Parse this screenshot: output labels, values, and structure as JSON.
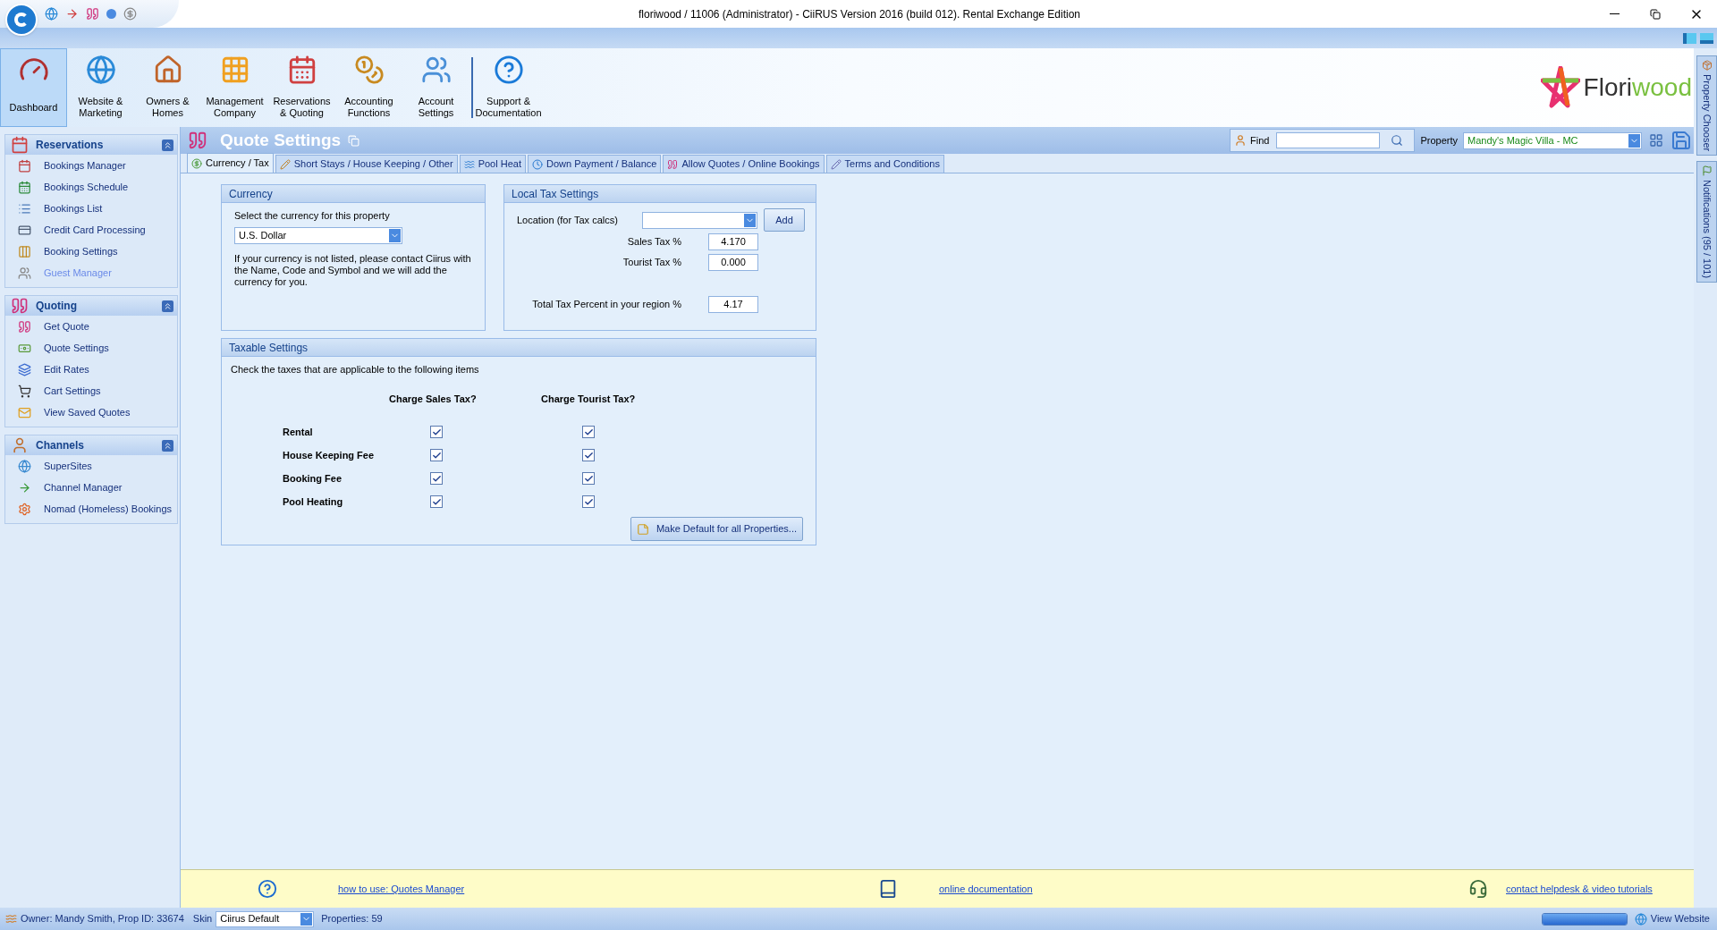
{
  "window": {
    "title": "floriwood / 11006 (Administrator) - CiiRUS Version 2016 (build 012). Rental Exchange Edition"
  },
  "toolbar": [
    {
      "label": "Dashboard",
      "selected": true
    },
    {
      "label": "Website & Marketing",
      "selected": false
    },
    {
      "label": "Owners & Homes",
      "selected": false
    },
    {
      "label": "Management Company",
      "selected": false
    },
    {
      "label": "Reservations & Quoting",
      "selected": false
    },
    {
      "label": "Accounting Functions",
      "selected": false
    },
    {
      "label": "Account Settings",
      "selected": false
    },
    {
      "label": "Support & Documentation",
      "selected": false
    }
  ],
  "logo": [
    "Flori",
    "wood"
  ],
  "side_tabs": [
    "Property Chooser",
    "Notifications (95 / 101)"
  ],
  "sidebar": [
    {
      "title": "Reservations",
      "items": [
        {
          "label": "Bookings Manager",
          "disabled": false
        },
        {
          "label": "Bookings Schedule",
          "disabled": false
        },
        {
          "label": "Bookings List",
          "disabled": false
        },
        {
          "label": "Credit Card Processing",
          "disabled": false
        },
        {
          "label": "Booking Settings",
          "disabled": false
        },
        {
          "label": "Guest Manager",
          "disabled": true
        }
      ]
    },
    {
      "title": "Quoting",
      "items": [
        {
          "label": "Get Quote",
          "disabled": false
        },
        {
          "label": "Quote Settings",
          "disabled": false
        },
        {
          "label": "Edit Rates",
          "disabled": false
        },
        {
          "label": "Cart Settings",
          "disabled": false
        },
        {
          "label": "View Saved Quotes",
          "disabled": false
        }
      ]
    },
    {
      "title": "Channels",
      "items": [
        {
          "label": "SuperSites",
          "disabled": false
        },
        {
          "label": "Channel Manager",
          "disabled": false
        },
        {
          "label": "Nomad (Homeless) Bookings",
          "disabled": false
        }
      ]
    }
  ],
  "page": {
    "title": "Quote Settings",
    "find_label": "Find",
    "property_label": "Property",
    "property_value": "Mandy's Magic Villa - MC"
  },
  "tabs": [
    {
      "label": "Currency / Tax",
      "selected": true
    },
    {
      "label": "Short Stays / House Keeping / Other",
      "selected": false
    },
    {
      "label": "Pool Heat",
      "selected": false
    },
    {
      "label": "Down Payment / Balance",
      "selected": false
    },
    {
      "label": "Allow Quotes / Online Bookings",
      "selected": false
    },
    {
      "label": "Terms and Conditions",
      "selected": false
    }
  ],
  "currency": {
    "title": "Currency",
    "prompt": "Select the currency for this property",
    "value": "U.S. Dollar",
    "note": "If your currency is not listed, please contact Ciirus with the Name, Code and Symbol and we will add the currency for you."
  },
  "local_tax": {
    "title": "Local Tax Settings",
    "location_label": "Location (for Tax calcs)",
    "add_button": "Add",
    "fields": [
      {
        "label": "Sales Tax %",
        "value": "4.170"
      },
      {
        "label": "Tourist Tax %",
        "value": "0.000"
      },
      {
        "label": "Total Tax Percent in your region %",
        "value": "4.17"
      }
    ]
  },
  "taxable": {
    "title": "Taxable Settings",
    "instruction": "Check the taxes that are applicable to the following items",
    "columns": [
      "Charge Sales Tax?",
      "Charge Tourist Tax?"
    ],
    "rows": [
      {
        "label": "Rental",
        "sales": true,
        "tourist": true
      },
      {
        "label": "House Keeping Fee",
        "sales": true,
        "tourist": true
      },
      {
        "label": "Booking Fee",
        "sales": true,
        "tourist": true
      },
      {
        "label": "Pool Heating",
        "sales": true,
        "tourist": true
      }
    ],
    "button": "Make Default for all Properties..."
  },
  "help_links": [
    "how to use: Quotes Manager",
    "online documentation",
    "contact helpdesk & video tutorials"
  ],
  "status_bar": {
    "owner": "Owner: Mandy Smith, Prop ID: 33674",
    "skin_label": "Skin",
    "skin": "Ciirus Default",
    "properties": "Properties: 59",
    "view_website": "View Website",
    "progress": {
      "level": 1
    }
  }
}
